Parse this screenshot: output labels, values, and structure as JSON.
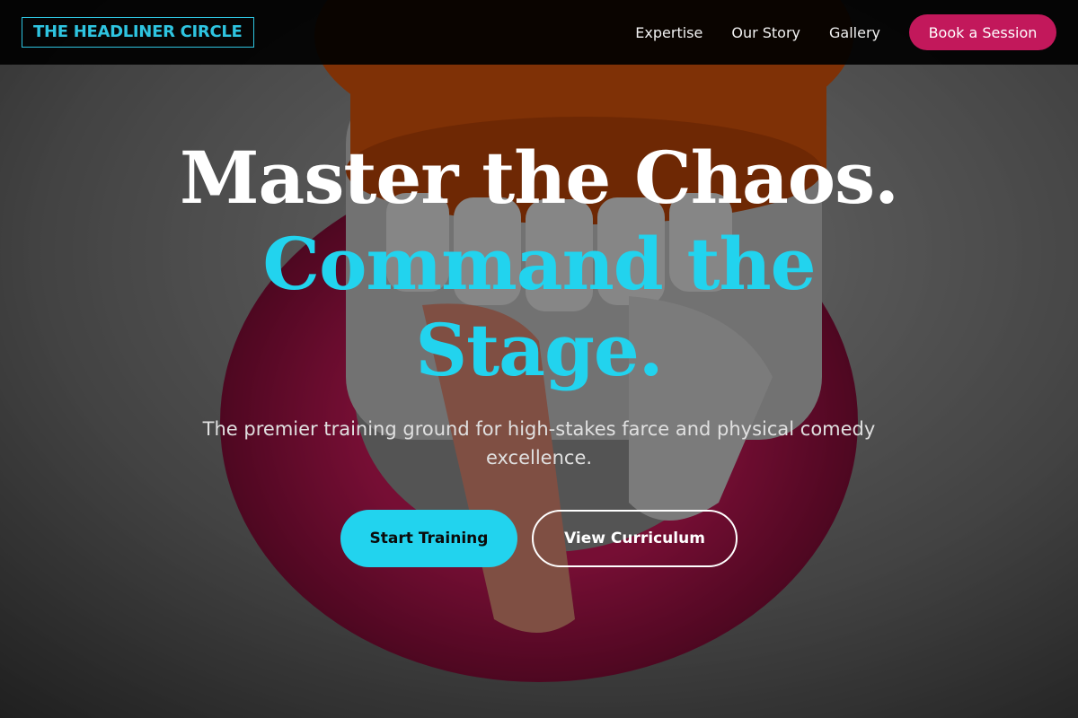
{
  "brand": {
    "logo_text": "THE HEADLINER CIRCLE"
  },
  "nav": {
    "links": [
      "Expertise",
      "Our Story",
      "Gallery"
    ],
    "cta_label": "Book a Session"
  },
  "hero": {
    "headline_line1": "Master the Chaos.",
    "headline_line2": "Command the Stage.",
    "subtitle": "The premier training ground for high-stakes farce and physical comedy excellence.",
    "primary_button": "Start Training",
    "secondary_button": "View Curriculum",
    "background_image": "chattering-teeth-toy"
  },
  "colors": {
    "accent_cyan": "#22d3ee",
    "accent_magenta": "#c2185b",
    "nav_background": "#000000"
  }
}
